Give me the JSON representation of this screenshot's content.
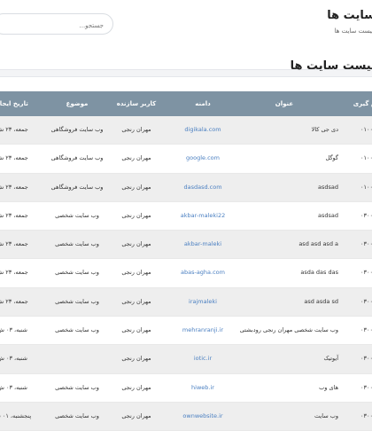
{
  "header": {
    "title": "سایت ها",
    "breadcrumb": "لیست سایت ها",
    "search_placeholder": "جستجو..."
  },
  "card": {
    "title": "لیست سایت ها"
  },
  "table": {
    "columns": [
      "نام گیری",
      "عنوان",
      "دامنه",
      "کاربر سازنده",
      "موضوع",
      "تاریخ ایجاد"
    ],
    "rows": [
      {
        "id": "۰۱۰۰",
        "title": "دی جی کالا",
        "domain": "digikala.com",
        "creator": "مهران رنجی",
        "topic": "وب سایت فروشگاهی",
        "date": "جمعه، ۲۳ ش"
      },
      {
        "id": "۰۱۰۰",
        "title": "گوگل",
        "domain": "google.com",
        "creator": "مهران رنجی",
        "topic": "وب سایت فروشگاهی",
        "date": "جمعه، ۲۳ ش"
      },
      {
        "id": "۰۱۰۰",
        "title": "asdsad",
        "domain": "dasdasd.com",
        "creator": "مهران رنجی",
        "topic": "وب سایت فروشگاهی",
        "date": "جمعه، ۲۳ ش"
      },
      {
        "id": "۰۳۰۰",
        "title": "asdsad",
        "domain": "akbar-maleki22",
        "creator": "مهران رنجی",
        "topic": "وب سایت شخصی",
        "date": "جمعه، ۲۳ ش"
      },
      {
        "id": "۰۳۰۰",
        "title": "asd asd asd a",
        "domain": "akbar-maleki",
        "creator": "مهران رنجی",
        "topic": "وب سایت شخصی",
        "date": "جمعه، ۲۳ ش"
      },
      {
        "id": "۰۳۰۰",
        "title": "asda das das",
        "domain": "abas-agha.com",
        "creator": "مهران رنجی",
        "topic": "وب سایت شخصی",
        "date": "جمعه، ۲۳ ش"
      },
      {
        "id": "۰۳۰۰",
        "title": "asd asda sd",
        "domain": "irajmaleki",
        "creator": "مهران رنجی",
        "topic": "وب سایت شخصی",
        "date": "جمعه، ۲۳ ش"
      },
      {
        "id": "۰۳۰۰",
        "title": "وب سایت شخصی مهران رنجی رودبشتی",
        "domain": "mehranranji.ir",
        "creator": "مهران رنجی",
        "topic": "وب سایت شخصی",
        "date": "شنبه، ۰۳ ش"
      },
      {
        "id": "۰۳۰۰",
        "title": "آیوتیک",
        "domain": "iotic.ir",
        "creator": "مهران رنجی",
        "topic": "",
        "date": "شنبه، ۰۳ ش"
      },
      {
        "id": "۰۳۰۰",
        "title": "های وب",
        "domain": "hiweb.ir",
        "creator": "مهران رنجی",
        "topic": "وب سایت شخصی",
        "date": "شنبه، ۰۳ ش"
      },
      {
        "id": "۰۳۰۰",
        "title": "وب سایت",
        "domain": "ownwebsite.ir",
        "creator": "مهران رنجی",
        "topic": "وب سایت شخصی",
        "date": "پنجشنبه، ۰۱ ش"
      }
    ]
  }
}
